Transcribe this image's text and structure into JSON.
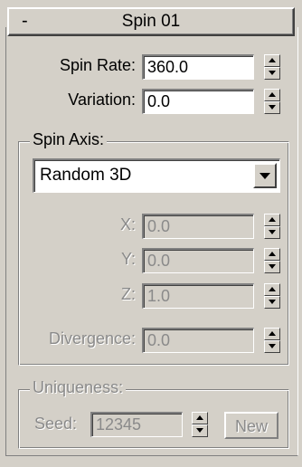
{
  "rollout": {
    "collapse_symbol": "-",
    "title": "Spin 01"
  },
  "spin_rate": {
    "label": "Spin Rate:",
    "value": "360.0"
  },
  "variation": {
    "label": "Variation:",
    "value": "0.0"
  },
  "spin_axis": {
    "group_title": "Spin Axis:",
    "selected": "Random 3D",
    "x": {
      "label": "X:",
      "value": "0.0"
    },
    "y": {
      "label": "Y:",
      "value": "0.0"
    },
    "z": {
      "label": "Z:",
      "value": "1.0"
    },
    "divergence": {
      "label": "Divergence:",
      "value": "0.0"
    }
  },
  "uniqueness": {
    "group_title": "Uniqueness:",
    "seed_label": "Seed:",
    "seed_value": "12345",
    "new_label": "New"
  }
}
